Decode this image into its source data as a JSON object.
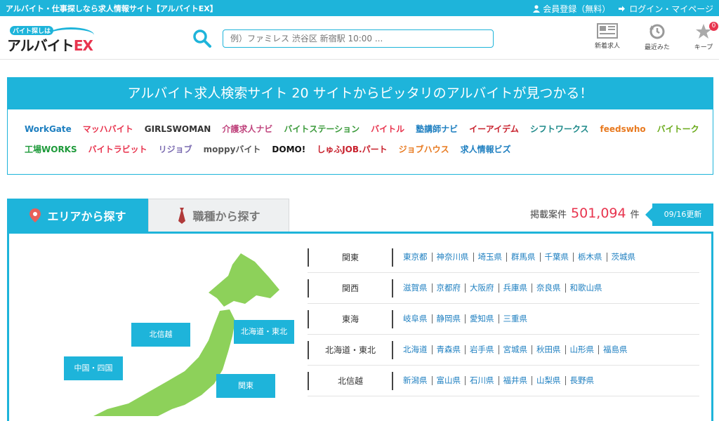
{
  "topbar": {
    "tagline": "アルバイト・仕事探しなら求人情報サイト【アルバイトEX】",
    "register": "会員登録（無料）",
    "login": "ログイン・マイページ"
  },
  "logo": {
    "sub": "バイト探しは",
    "main": "アルバイト",
    "ex": "EX"
  },
  "search": {
    "placeholder": "例）ファミレス 渋谷区 新宿駅 10:00 ..."
  },
  "header_icons": {
    "new": "新着求人",
    "recent": "最近みた",
    "keep": "キープ",
    "keep_count": "0"
  },
  "sites": {
    "title": "アルバイト求人検索サイト 20 サイトからピッタリのアルバイトが見つかる！",
    "row1": [
      "WorkGate",
      "マッハバイト",
      "GIRLSWOMAN",
      "介護求人ナビ",
      "バイトステーション",
      "バイトル",
      "塾講師ナビ",
      "イーアイデム",
      "シフトワークス",
      "feedswho",
      "バイトーク"
    ],
    "row2": [
      "工場WORKS",
      "バイトラビット",
      "リジョブ",
      "moppyバイト",
      "DOMO!",
      "しゅふJOB.パート",
      "ジョブハウス",
      "求人情報ビズ"
    ],
    "colors1": [
      "#1e7fc0",
      "#e8344e",
      "#333333",
      "#c0457e",
      "#3a9a3a",
      "#e8344e",
      "#1e7fc0",
      "#c8202c",
      "#1e8a8a",
      "#e87a20",
      "#6aaa1a"
    ],
    "colors2": [
      "#1e9a3a",
      "#e8344e",
      "#7a6ab0",
      "#555555",
      "#111111",
      "#c8202c",
      "#e87a20",
      "#1e7fc0"
    ]
  },
  "tabs": {
    "area": "エリアから探す",
    "job": "職種から探す"
  },
  "count": {
    "label": "掲載案件",
    "value": "501,094",
    "unit": "件",
    "updated": "09/16更新"
  },
  "map_regions": {
    "hokushinetsu": "北信越",
    "hokkaido_tohoku": "北海道・東北",
    "chugoku_shikoku": "中国・四国",
    "kanto": "関東"
  },
  "regions": [
    {
      "name": "関東",
      "prefs": [
        "東京都",
        "神奈川県",
        "埼玉県",
        "群馬県",
        "千葉県",
        "栃木県",
        "茨城県"
      ]
    },
    {
      "name": "関西",
      "prefs": [
        "滋賀県",
        "京都府",
        "大阪府",
        "兵庫県",
        "奈良県",
        "和歌山県"
      ]
    },
    {
      "name": "東海",
      "prefs": [
        "岐阜県",
        "静岡県",
        "愛知県",
        "三重県"
      ]
    },
    {
      "name": "北海道・東北",
      "prefs": [
        "北海道",
        "青森県",
        "岩手県",
        "宮城県",
        "秋田県",
        "山形県",
        "福島県"
      ]
    },
    {
      "name": "北信越",
      "prefs": [
        "新潟県",
        "富山県",
        "石川県",
        "福井県",
        "山梨県",
        "長野県"
      ]
    }
  ],
  "colors": {
    "accent": "#1eb4da",
    "count": "#e8344e",
    "link": "#1e7fc0",
    "map": "#8dd15a"
  }
}
